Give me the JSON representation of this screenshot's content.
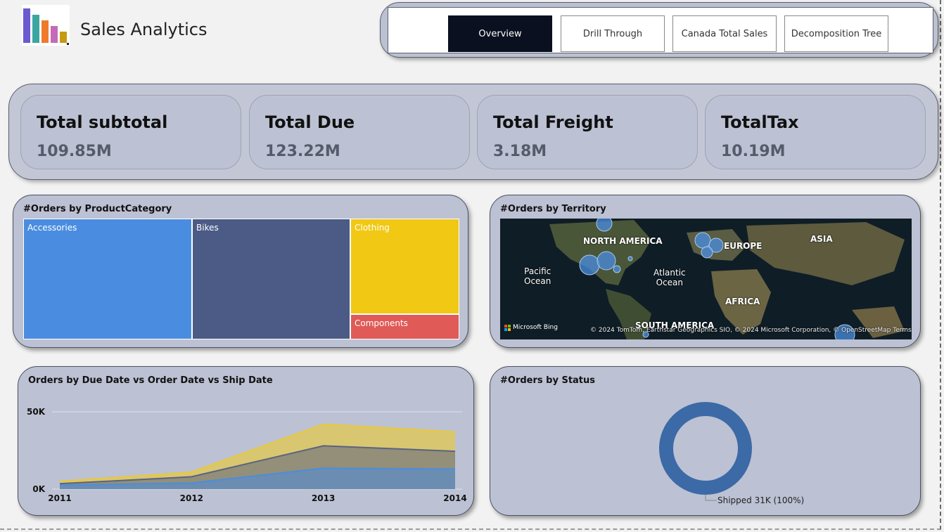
{
  "app": {
    "title": "Sales Analytics"
  },
  "nav": {
    "tabs": [
      {
        "label": "Overview",
        "active": true
      },
      {
        "label": "Drill Through",
        "active": false
      },
      {
        "label": "Canada Total Sales",
        "active": false
      },
      {
        "label": "Decomposition Tree",
        "active": false
      }
    ]
  },
  "kpis": [
    {
      "title": "Total subtotal",
      "value": "109.85M"
    },
    {
      "title": "Total Due",
      "value": "123.22M"
    },
    {
      "title": "Total Freight",
      "value": "3.18M"
    },
    {
      "title": "TotalTax",
      "value": "10.19M"
    }
  ],
  "treemap": {
    "title": "#Orders by ProductCategory",
    "items": [
      {
        "label": "Accessories",
        "color": "#4a8de0"
      },
      {
        "label": "Bikes",
        "color": "#4b5b86"
      },
      {
        "label": "Clothing",
        "color": "#f1c814"
      },
      {
        "label": "Components",
        "color": "#e05a57"
      }
    ]
  },
  "map": {
    "title": "#Orders by Territory",
    "labels": [
      "NORTH AMERICA",
      "EUROPE",
      "ASIA",
      "AFRICA",
      "SOUTH AMERICA"
    ],
    "oceans": [
      "Pacific\nOcean",
      "Atlantic\nOcean"
    ],
    "bing": "Microsoft Bing",
    "credit": "© 2024 TomTom, Earthstar Geographics SIO, © 2024 Microsoft Corporation, © OpenStreetMap Terms"
  },
  "chart_data": [
    {
      "type": "area",
      "title": "Orders by Due Date vs Order Date vs Ship Date",
      "x": [
        "2011",
        "2012",
        "2013",
        "2014"
      ],
      "yticks": [
        "0K",
        "50K"
      ],
      "ylim": [
        0,
        50000
      ],
      "series": [
        {
          "values": [
            5000,
            11000,
            42000,
            37000
          ],
          "color": "#e8c93a"
        },
        {
          "values": [
            3500,
            8000,
            28000,
            24500
          ],
          "color": "#5a6380"
        },
        {
          "values": [
            2500,
            4000,
            13500,
            13000
          ],
          "color": "#4a8de0"
        }
      ],
      "grid": true
    },
    {
      "type": "pie",
      "title": "#Orders by Status",
      "slices": [
        {
          "label": "Shipped 31K (100%)",
          "value": 31000,
          "color": "#3b6aa6"
        }
      ]
    }
  ]
}
